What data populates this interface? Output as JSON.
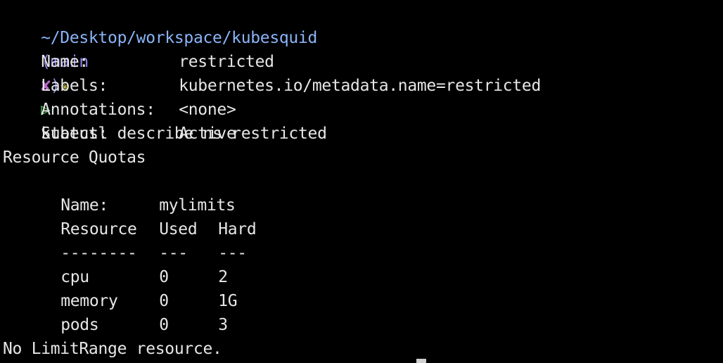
{
  "prompt": {
    "path": "~/Desktop/workspace/kubesquid",
    "branch_open": "(",
    "branch": "main",
    "dirty_mark": "✘",
    "branch_close": ")",
    "star": "✭",
    "arrow": "▷",
    "command": "kubectl describe ns restricted"
  },
  "namespace": {
    "name_label": "Name:",
    "name_value": "restricted",
    "labels_label": "Labels:",
    "labels_value": "kubernetes.io/metadata.name=restricted",
    "annotations_label": "Annotations:",
    "annotations_value": "<none>",
    "status_label": "Status:",
    "status_value": "Active"
  },
  "quotas": {
    "heading": "Resource Quotas",
    "name_label": "Name:",
    "name_value": "mylimits",
    "headers": [
      "Resource",
      "Used",
      "Hard"
    ],
    "separators": [
      "--------",
      "---",
      "---"
    ],
    "rows": [
      {
        "resource": "cpu",
        "used": "0",
        "hard": "2"
      },
      {
        "resource": "memory",
        "used": "0",
        "hard": "1G"
      },
      {
        "resource": "pods",
        "used": "0",
        "hard": "3"
      }
    ]
  },
  "limitrange": {
    "message": "No LimitRange resource."
  },
  "colors": {
    "background": "#000000",
    "foreground": "#e6e6e6",
    "path": "#8ab4f8",
    "branch": "#8e86e8",
    "dirty": "#b766c9",
    "star": "#c9c24a",
    "prompt_arrow": "#56c25a"
  }
}
